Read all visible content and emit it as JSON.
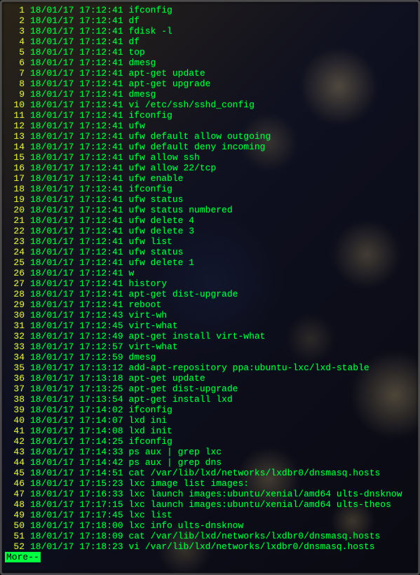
{
  "more_prompt": "More--",
  "lines": [
    {
      "n": 1,
      "date": "18/01/17",
      "time": "17:12:41",
      "cmd": "ifconfig"
    },
    {
      "n": 2,
      "date": "18/01/17",
      "time": "17:12:41",
      "cmd": "df"
    },
    {
      "n": 3,
      "date": "18/01/17",
      "time": "17:12:41",
      "cmd": "fdisk -l"
    },
    {
      "n": 4,
      "date": "18/01/17",
      "time": "17:12:41",
      "cmd": "df"
    },
    {
      "n": 5,
      "date": "18/01/17",
      "time": "17:12:41",
      "cmd": "top"
    },
    {
      "n": 6,
      "date": "18/01/17",
      "time": "17:12:41",
      "cmd": "dmesg"
    },
    {
      "n": 7,
      "date": "18/01/17",
      "time": "17:12:41",
      "cmd": "apt-get update"
    },
    {
      "n": 8,
      "date": "18/01/17",
      "time": "17:12:41",
      "cmd": "apt-get upgrade"
    },
    {
      "n": 9,
      "date": "18/01/17",
      "time": "17:12:41",
      "cmd": "dmesg"
    },
    {
      "n": 10,
      "date": "18/01/17",
      "time": "17:12:41",
      "cmd": "vi /etc/ssh/sshd_config"
    },
    {
      "n": 11,
      "date": "18/01/17",
      "time": "17:12:41",
      "cmd": "ifconfig"
    },
    {
      "n": 12,
      "date": "18/01/17",
      "time": "17:12:41",
      "cmd": "ufw"
    },
    {
      "n": 13,
      "date": "18/01/17",
      "time": "17:12:41",
      "cmd": "ufw default allow outgoing"
    },
    {
      "n": 14,
      "date": "18/01/17",
      "time": "17:12:41",
      "cmd": "ufw default deny incoming"
    },
    {
      "n": 15,
      "date": "18/01/17",
      "time": "17:12:41",
      "cmd": "ufw allow ssh"
    },
    {
      "n": 16,
      "date": "18/01/17",
      "time": "17:12:41",
      "cmd": "ufw allow 22/tcp"
    },
    {
      "n": 17,
      "date": "18/01/17",
      "time": "17:12:41",
      "cmd": "ufw enable"
    },
    {
      "n": 18,
      "date": "18/01/17",
      "time": "17:12:41",
      "cmd": "ifconfig"
    },
    {
      "n": 19,
      "date": "18/01/17",
      "time": "17:12:41",
      "cmd": "ufw status"
    },
    {
      "n": 20,
      "date": "18/01/17",
      "time": "17:12:41",
      "cmd": "ufw status numbered"
    },
    {
      "n": 21,
      "date": "18/01/17",
      "time": "17:12:41",
      "cmd": "ufw delete 4"
    },
    {
      "n": 22,
      "date": "18/01/17",
      "time": "17:12:41",
      "cmd": "ufw delete 3"
    },
    {
      "n": 23,
      "date": "18/01/17",
      "time": "17:12:41",
      "cmd": "ufw list"
    },
    {
      "n": 24,
      "date": "18/01/17",
      "time": "17:12:41",
      "cmd": "ufw status"
    },
    {
      "n": 25,
      "date": "18/01/17",
      "time": "17:12:41",
      "cmd": "ufw delete 1"
    },
    {
      "n": 26,
      "date": "18/01/17",
      "time": "17:12:41",
      "cmd": "w"
    },
    {
      "n": 27,
      "date": "18/01/17",
      "time": "17:12:41",
      "cmd": "history"
    },
    {
      "n": 28,
      "date": "18/01/17",
      "time": "17:12:41",
      "cmd": "apt-get dist-upgrade"
    },
    {
      "n": 29,
      "date": "18/01/17",
      "time": "17:12:41",
      "cmd": "reboot"
    },
    {
      "n": 30,
      "date": "18/01/17",
      "time": "17:12:43",
      "cmd": "virt-wh"
    },
    {
      "n": 31,
      "date": "18/01/17",
      "time": "17:12:45",
      "cmd": "virt-what"
    },
    {
      "n": 32,
      "date": "18/01/17",
      "time": "17:12:49",
      "cmd": "apt-get install virt-what"
    },
    {
      "n": 33,
      "date": "18/01/17",
      "time": "17:12:57",
      "cmd": "virt-what"
    },
    {
      "n": 34,
      "date": "18/01/17",
      "time": "17:12:59",
      "cmd": "dmesg"
    },
    {
      "n": 35,
      "date": "18/01/17",
      "time": "17:13:12",
      "cmd": "add-apt-repository ppa:ubuntu-lxc/lxd-stable"
    },
    {
      "n": 36,
      "date": "18/01/17",
      "time": "17:13:18",
      "cmd": "apt-get update"
    },
    {
      "n": 37,
      "date": "18/01/17",
      "time": "17:13:25",
      "cmd": "apt-get dist-upgrade"
    },
    {
      "n": 38,
      "date": "18/01/17",
      "time": "17:13:54",
      "cmd": "apt-get install lxd"
    },
    {
      "n": 39,
      "date": "18/01/17",
      "time": "17:14:02",
      "cmd": "ifconfig"
    },
    {
      "n": 40,
      "date": "18/01/17",
      "time": "17:14:07",
      "cmd": "lxd ini"
    },
    {
      "n": 41,
      "date": "18/01/17",
      "time": "17:14:08",
      "cmd": "lxd init"
    },
    {
      "n": 42,
      "date": "18/01/17",
      "time": "17:14:25",
      "cmd": "ifconfig"
    },
    {
      "n": 43,
      "date": "18/01/17",
      "time": "17:14:33",
      "cmd": "ps aux | grep lxc"
    },
    {
      "n": 44,
      "date": "18/01/17",
      "time": "17:14:42",
      "cmd": "ps aux | grep dns"
    },
    {
      "n": 45,
      "date": "18/01/17",
      "time": "17:14:51",
      "cmd": "cat /var/lib/lxd/networks/lxdbr0/dnsmasq.hosts"
    },
    {
      "n": 46,
      "date": "18/01/17",
      "time": "17:15:23",
      "cmd": "lxc image list images:"
    },
    {
      "n": 47,
      "date": "18/01/17",
      "time": "17:16:33",
      "cmd": "lxc launch images:ubuntu/xenial/amd64 ults-dnsknow"
    },
    {
      "n": 48,
      "date": "18/01/17",
      "time": "17:17:15",
      "cmd": "lxc launch images:ubuntu/xenial/amd64 ults-theos"
    },
    {
      "n": 49,
      "date": "18/01/17",
      "time": "17:17:45",
      "cmd": "lxc list"
    },
    {
      "n": 50,
      "date": "18/01/17",
      "time": "17:18:00",
      "cmd": "lxc info ults-dnsknow"
    },
    {
      "n": 51,
      "date": "18/01/17",
      "time": "17:18:09",
      "cmd": "cat /var/lib/lxd/networks/lxdbr0/dnsmasq.hosts"
    },
    {
      "n": 52,
      "date": "18/01/17",
      "time": "17:18:23",
      "cmd": "vi /var/lib/lxd/networks/lxdbr0/dnsmasq.hosts"
    }
  ]
}
